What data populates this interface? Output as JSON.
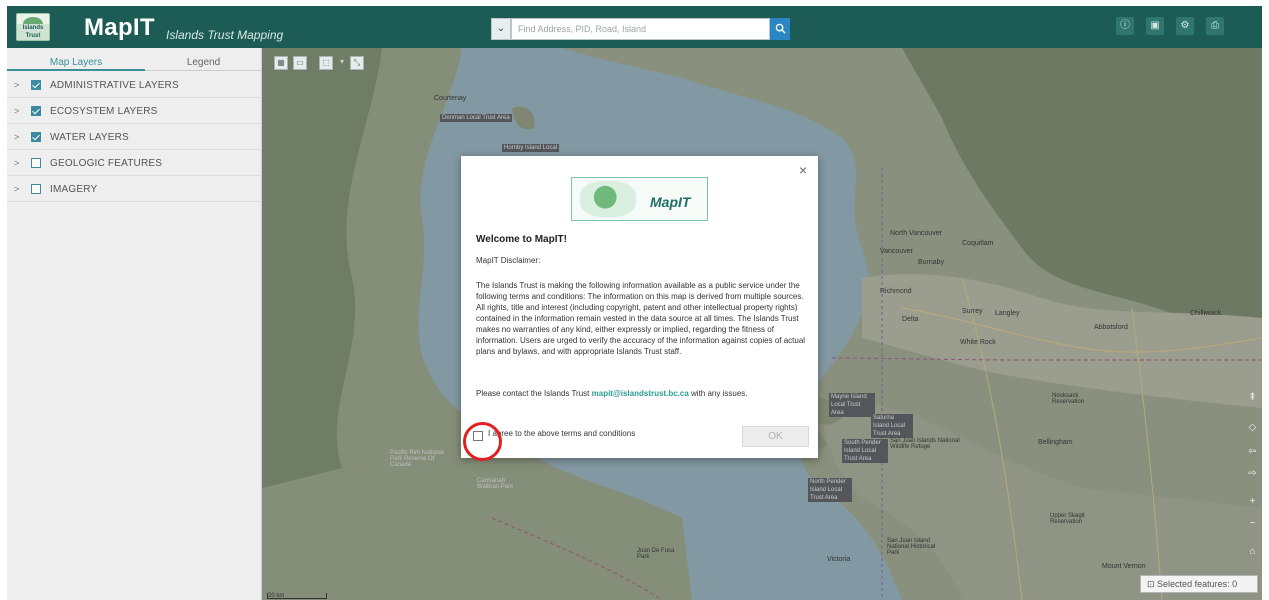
{
  "header": {
    "logo_caption": "Islands Trust",
    "title": "MapIT",
    "subtitle": "Islands Trust Mapping",
    "search": {
      "placeholder": "Find Address, PID, Road, Island",
      "dropdown_icon": "chevron-down-icon",
      "button_icon": "search-icon"
    },
    "buttons": [
      {
        "icon": "info-icon",
        "glyph": "ⓘ"
      },
      {
        "icon": "save-icon",
        "glyph": "▣"
      },
      {
        "icon": "tools-icon",
        "glyph": "⚙"
      },
      {
        "icon": "print-icon",
        "glyph": "⎙"
      }
    ]
  },
  "sidebar": {
    "tabs": [
      {
        "label": "Map Layers",
        "active": true
      },
      {
        "label": "Legend",
        "active": false
      }
    ],
    "layers": [
      {
        "label": "ADMINISTRATIVE LAYERS",
        "checked": true
      },
      {
        "label": "ECOSYSTEM LAYERS",
        "checked": true
      },
      {
        "label": "WATER LAYERS",
        "checked": true
      },
      {
        "label": "GEOLOGIC FEATURES",
        "checked": false
      },
      {
        "label": "IMAGERY",
        "checked": false
      }
    ]
  },
  "map": {
    "places": [
      {
        "text": "Courtenay",
        "style": ""
      },
      {
        "text": "Denman Local Trust Area",
        "style": "tag"
      },
      {
        "text": "Hornby Island Local",
        "style": "tag"
      },
      {
        "text": "North Vancouver",
        "style": ""
      },
      {
        "text": "Coquitlam",
        "style": ""
      },
      {
        "text": "Vancouver",
        "style": ""
      },
      {
        "text": "Burnaby",
        "style": ""
      },
      {
        "text": "Richmond",
        "style": ""
      },
      {
        "text": "Surrey",
        "style": ""
      },
      {
        "text": "Langley",
        "style": ""
      },
      {
        "text": "Delta",
        "style": ""
      },
      {
        "text": "Chilliwack",
        "style": ""
      },
      {
        "text": "Abbotsford",
        "style": ""
      },
      {
        "text": "White Rock",
        "style": ""
      },
      {
        "text": "Mayne Island Local Trust Area",
        "style": "tag"
      },
      {
        "text": "Saturna Island Local Trust Area",
        "style": "tag"
      },
      {
        "text": "South Pender Island Local Trust Area",
        "style": "tag"
      },
      {
        "text": "North Pender Island Local Trust Area",
        "style": "tag"
      },
      {
        "text": "San Juan Islands National Wildlife Refuge",
        "style": ""
      },
      {
        "text": "Bellingham",
        "style": ""
      },
      {
        "text": "Pacific Rim National Park Reserve Of Canada",
        "style": "light"
      },
      {
        "text": "Carmanah Walbran Park",
        "style": "light"
      },
      {
        "text": "Victoria",
        "style": ""
      },
      {
        "text": "Juan De Fuca Park",
        "style": ""
      },
      {
        "text": "San Juan Island National Historical Park",
        "style": ""
      },
      {
        "text": "Mount Vernon",
        "style": ""
      },
      {
        "text": "Nooksack Reservation",
        "style": ""
      },
      {
        "text": "Upper Skagit Reservation",
        "style": ""
      }
    ],
    "selected_features_label": "Selected features: 0",
    "scale_label": "20 km",
    "controls": [
      {
        "name": "compass-icon",
        "glyph": "⇞"
      },
      {
        "name": "locate-icon",
        "glyph": "◇"
      },
      {
        "name": "previous-extent-icon",
        "glyph": "⇦"
      },
      {
        "name": "next-extent-icon",
        "glyph": "⇨"
      },
      {
        "name": "zoom-in-icon",
        "glyph": "+"
      },
      {
        "name": "zoom-out-icon",
        "glyph": "−"
      },
      {
        "name": "home-icon",
        "glyph": "⌂"
      }
    ]
  },
  "modal": {
    "logo_text": "MapIT",
    "title": "Welcome to MapIT!",
    "subtitle": "MapIT Disclaimer:",
    "body": "The Islands Trust is making the following information available as a public service under the following terms and conditions: The information on this map is derived from multiple sources. All rights, title and interest (including copyright, patent and other intellectual property rights) contained in the information remain vested in the data source at all times. The Islands Trust makes no warranties of any kind, either expressly or implied, regarding the fitness of information. Users are urged to verify the accuracy of the information against copies of actual plans and bylaws, and with appropriate Islands Trust staff.",
    "contact_prefix": "Please contact the Islands Trust ",
    "contact_email": "mapit@islandstrust.bc.ca",
    "contact_suffix": " with any issues.",
    "agree_label": "I agree to the above terms and conditions",
    "agree_checked": false,
    "ok_label": "OK",
    "close_glyph": "×"
  }
}
